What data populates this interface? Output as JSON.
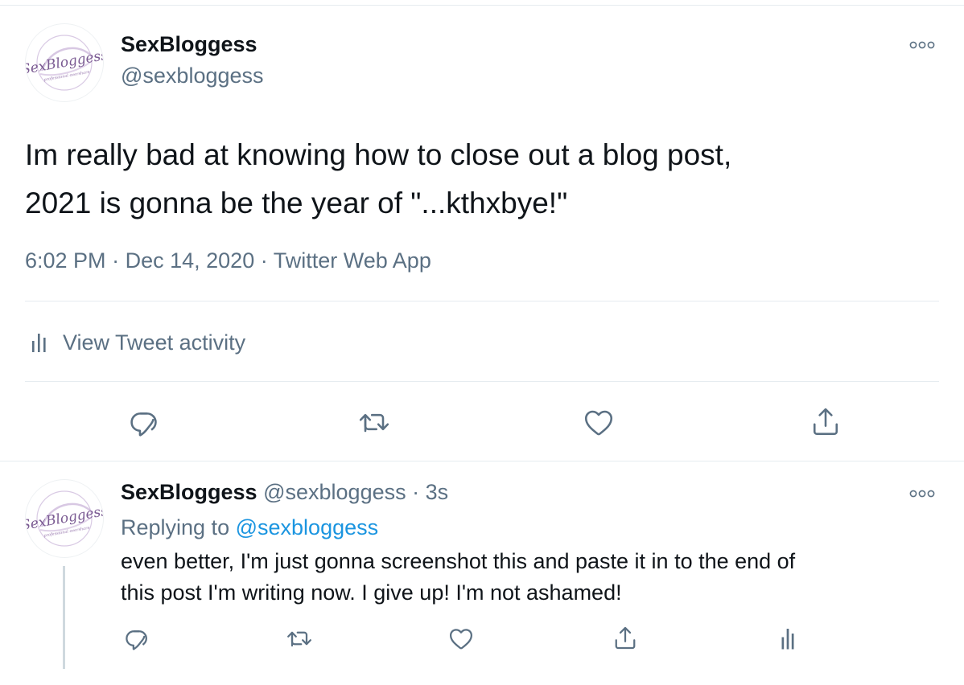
{
  "tweet": {
    "avatar_icon": "sexbloggess-logo-avatar",
    "display_name": "SexBloggess",
    "handle": "@sexbloggess",
    "text_lines": [
      "Im really bad at knowing how to close out a blog post,",
      "2021 is gonna be the year of \"...kthxbye!\""
    ],
    "time": "6:02 PM",
    "separator": "·",
    "date": "Dec 14, 2020",
    "source": "Twitter Web App",
    "activity_label": "View Tweet activity",
    "actions": [
      "reply-icon",
      "retweet-icon",
      "like-icon",
      "share-icon"
    ],
    "more_icon": "more-options-icon"
  },
  "reply": {
    "avatar_icon": "sexbloggess-logo-avatar",
    "display_name": "SexBloggess",
    "handle": "@sexbloggess",
    "separator": "·",
    "time_ago": "3s",
    "replying_to_label": "Replying to",
    "replying_to_handle": "@sexbloggess",
    "text_lines": [
      "even better, I'm just gonna screenshot this and paste it in to the end of",
      "this post I'm writing now. I give up! I'm not ashamed!"
    ],
    "actions": [
      "reply-icon",
      "retweet-icon",
      "like-icon",
      "share-icon",
      "analytics-icon"
    ],
    "more_icon": "more-options-icon"
  },
  "colors": {
    "text_primary": "#0f1419",
    "text_secondary": "#5b7083",
    "link": "#1b95e0",
    "border": "#e6ecf0",
    "icon": "#5b7083",
    "logo_purple": "#7a5a92"
  }
}
